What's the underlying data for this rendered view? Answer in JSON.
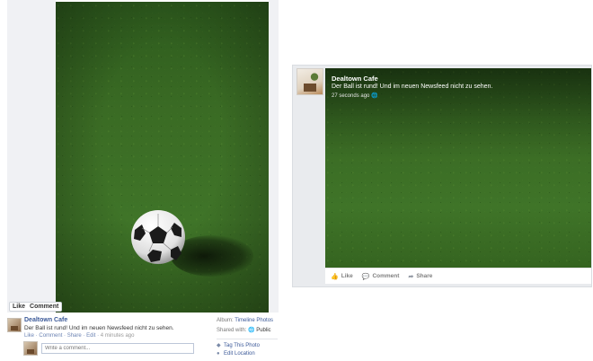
{
  "left_view": {
    "photo_alt": "soccer ball on grass",
    "like_box": {
      "like_label": "Like",
      "comment_label": "Comment"
    },
    "post": {
      "author": "Dealtown Cafe",
      "text": "Der Ball ist rund! Und im neuen Newsfeed nicht zu sehen.",
      "actions": {
        "like": "Like",
        "comment": "Comment",
        "share": "Share",
        "edit": "Edit",
        "separator": " · ",
        "timestamp": "4 minutes ago"
      }
    },
    "comment_box": {
      "placeholder": "Write a comment..."
    },
    "side_info": {
      "album_label": "Album:",
      "album_value": "Timeline Photos",
      "shared_label": "Shared with:",
      "shared_value": "Public",
      "tag_photo": "Tag This Photo",
      "edit_location": "Edit Location"
    }
  },
  "right_view": {
    "author": "Dealtown Cafe",
    "text": "Der Ball ist rund! Und im neuen Newsfeed nicht zu sehen.",
    "timestamp": "27 seconds ago",
    "actions": {
      "like": "Like",
      "comment": "Comment",
      "share": "Share"
    }
  },
  "icons": {
    "globe": "globe-icon",
    "tag": "tag-icon",
    "location": "location-pin-icon",
    "like": "thumbs-up-icon",
    "comment": "comment-icon",
    "share": "share-arrow-icon"
  },
  "colors": {
    "link": "#3b5998",
    "grass": "#3a6b24",
    "panel_bg": "#e9ebee"
  }
}
